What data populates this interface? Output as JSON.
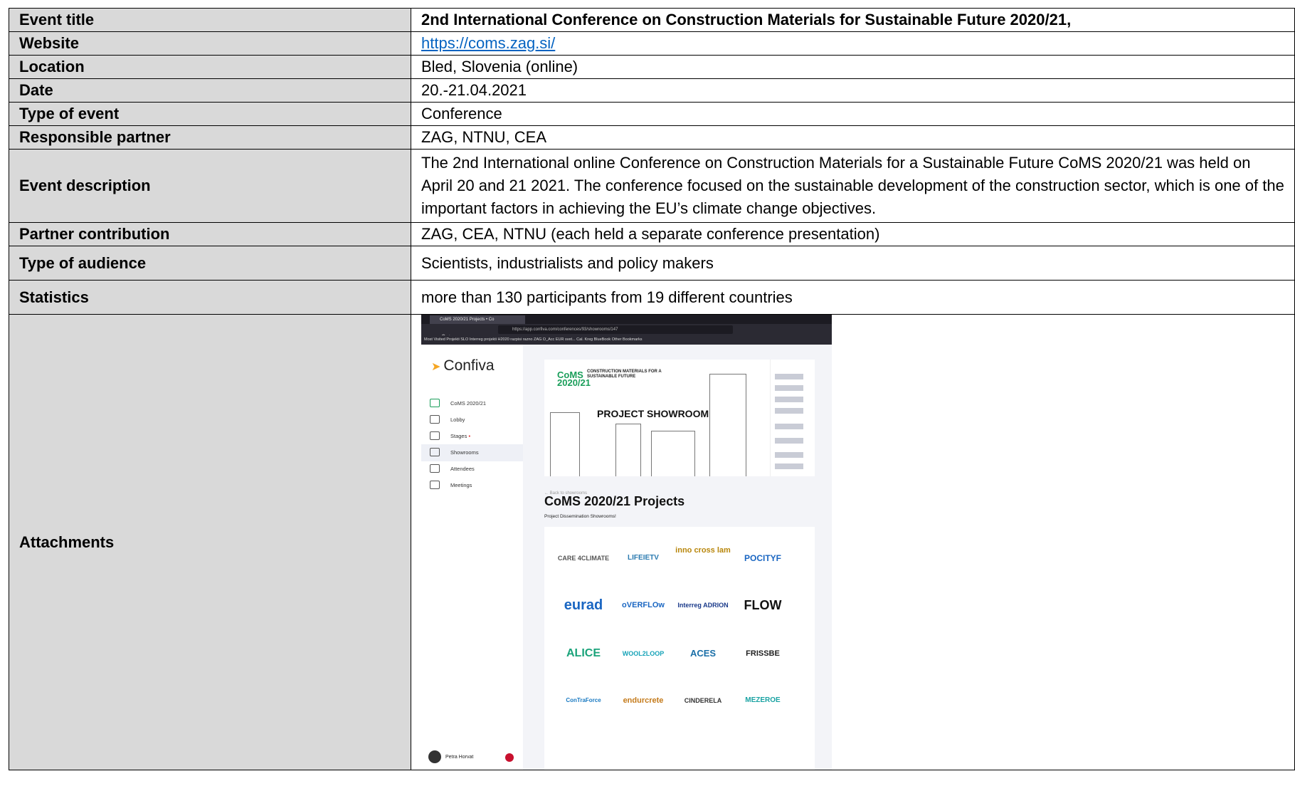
{
  "rows": [
    {
      "label": "Event title",
      "value": "2nd International Conference on Construction Materials for Sustainable Future 2020/21,"
    },
    {
      "label": "Website",
      "value": "https://coms.zag.si/"
    },
    {
      "label": "Location",
      "value": "Bled, Slovenia (online)"
    },
    {
      "label": "Date",
      "value": "20.-21.04.2021"
    },
    {
      "label": "Type of event",
      "value": "Conference"
    },
    {
      "label": "Responsible partner",
      "value": "ZAG, NTNU, CEA"
    },
    {
      "label": "Event description",
      "value": "The 2nd International online Conference on Construction Materials for a Sustainable Future CoMS 2020/21 was held on April 20 and 21 2021. The conference focused on the sustainable development of the construction sector, which is one of the important factors in achieving the EU’s climate change objectives."
    },
    {
      "label": "Partner contribution",
      "value": "ZAG, CEA, NTNU (each held a separate conference presentation)"
    },
    {
      "label": "Type of audience",
      "value": "Scientists, industrialists and policy makers"
    },
    {
      "label": "Statistics",
      "value": "more than 130 participants from 19 different countries"
    },
    {
      "label": "Attachments",
      "value": ""
    }
  ],
  "screenshot": {
    "browser_tab": "CoMS 2020/21 Projects • Co",
    "url": "https://app.confiva.com/conferences/93/showrooms/147",
    "bookmarks": "Most Visited   Projekti SLO   Interreg projekti   H2020   razpisi   razno   ZAG   O_Acc   EUR svet...   Cal. Kreg   BlueBook   Other Bookmarks",
    "brand": "Confiva",
    "nav": [
      "CoMS 2020/21",
      "Lobby",
      "Stages",
      "Showrooms",
      "Attendees",
      "Meetings"
    ],
    "user_name": "Petra Horvat",
    "banner_logo": "CoMS 2020/21",
    "banner_heading": "CONSTRUCTION MATERIALS FOR A SUSTAINABLE FUTURE",
    "banner_title": "PROJECT SHOWROOM",
    "back_link": "← Back to showrooms",
    "page_title": "CoMS 2020/21 Projects",
    "page_subtitle": "Project Dissemination Showrooms!",
    "projects": [
      "CARE 4CLIMATE",
      "LIFEIETV",
      "inno cross lam",
      "POCITYF",
      "eurad",
      "oVERFLOw",
      "Interreg ADRION",
      "FLOW",
      "ALICE",
      "WOOL2LOOP",
      "ACES",
      "FRISSBE",
      "ConTraForce",
      "endurcrete",
      "CINDERELA",
      "MEZEROE"
    ]
  }
}
